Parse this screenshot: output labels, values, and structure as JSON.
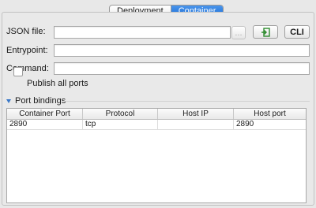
{
  "tabs": [
    {
      "label": "Deployment",
      "active": false
    },
    {
      "label": "Container",
      "active": true
    }
  ],
  "form": {
    "json_file_label": "JSON file:",
    "json_file_value": "",
    "browse_label": "...",
    "cli_label": "CLI",
    "entrypoint_label": "Entrypoint:",
    "entrypoint_value": "",
    "command_label": "Command:",
    "command_value": "",
    "publish_all_label": "Publish all ports",
    "publish_all_checked": false
  },
  "port_bindings": {
    "title": "Port bindings",
    "columns": [
      "Container Port",
      "Protocol",
      "Host IP",
      "Host port"
    ],
    "rows": [
      [
        "2890",
        "tcp",
        "",
        "2890"
      ]
    ]
  },
  "colors": {
    "accent": "#2a7de1",
    "import_icon": "#2e8b2e"
  },
  "icons": {
    "import": "import-arrow-icon",
    "section_toggle": "disclosure-triangle-icon"
  }
}
